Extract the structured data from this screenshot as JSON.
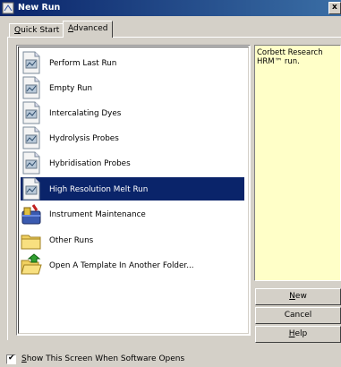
{
  "window": {
    "title": "New Run"
  },
  "tabs": [
    {
      "prefix": "",
      "hotkey": "Q",
      "rest": "uick Start"
    },
    {
      "prefix": "",
      "hotkey": "A",
      "rest": "dvanced"
    }
  ],
  "active_tab": 1,
  "run_list": [
    {
      "label": "Perform Last Run",
      "icon": "document-icon"
    },
    {
      "label": "Empty Run",
      "icon": "document-icon"
    },
    {
      "label": "Intercalating Dyes",
      "icon": "document-icon"
    },
    {
      "label": "Hydrolysis Probes",
      "icon": "document-icon"
    },
    {
      "label": "Hybridisation Probes",
      "icon": "document-icon"
    },
    {
      "label": "High Resolution Melt Run",
      "icon": "document-icon",
      "selected": true
    },
    {
      "label": "Instrument Maintenance",
      "icon": "toolbox-icon"
    },
    {
      "label": "Other Runs",
      "icon": "folder-icon"
    },
    {
      "label": "Open A Template In Another Folder...",
      "icon": "folder-open-icon"
    }
  ],
  "description": "Corbett Research HRM™ run.",
  "buttons": {
    "new": {
      "hotkey": "N",
      "rest": "ew"
    },
    "cancel": {
      "label": "Cancel"
    },
    "help": {
      "hotkey": "H",
      "rest": "elp"
    }
  },
  "show_on_open": {
    "checked": true,
    "check_mark": "✔",
    "hotkey": "S",
    "rest": "how This Screen When Software Opens"
  },
  "close_glyph": "x",
  "colors": {
    "titlebar": "#0a246a",
    "selection": "#0a246a",
    "description_bg": "#ffffc8"
  }
}
